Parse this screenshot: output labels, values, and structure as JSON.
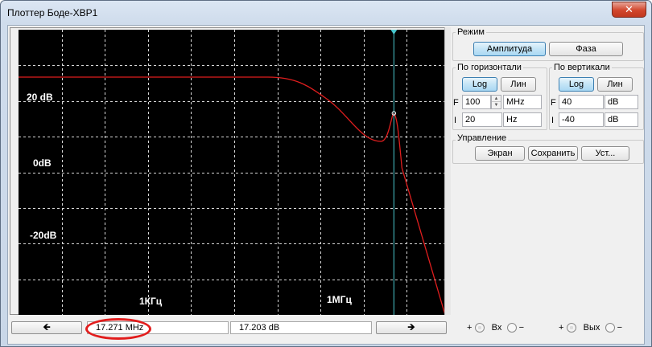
{
  "window": {
    "title": "Плоттер Боде-XBP1",
    "close_label": "✕"
  },
  "plot": {
    "labels": {
      "db20": "20 dB",
      "db0": "0dB",
      "dbm20": "-20dB",
      "f1k": "1КГц",
      "f1m": "1МГц"
    },
    "colors": {
      "trace": "#e01e1e",
      "cursor": "#49c8cf",
      "grid": "#d8d8d8",
      "background": "#000000"
    },
    "cursor_position": 0.87
  },
  "bottombar": {
    "left_arrow": "🡸",
    "right_arrow": "🡺",
    "frequency": "17.271 MHz",
    "gain": "17.203 dB"
  },
  "mode": {
    "title": "Режим",
    "amplitude": "Амплитуда",
    "phase": "Фаза"
  },
  "horizontal": {
    "title": "По горизонтали",
    "log": "Log",
    "lin": "Лин",
    "f_label": "F",
    "i_label": "I",
    "f_value": "100",
    "f_unit": "MHz",
    "i_value": "20",
    "i_unit": "Hz"
  },
  "vertical": {
    "title": "По вертикали",
    "log": "Log",
    "lin": "Лин",
    "f_label": "F",
    "i_label": "I",
    "f_value": "40",
    "f_unit": "dB",
    "i_value": "-40",
    "i_unit": "dB"
  },
  "control": {
    "title": "Управление",
    "screen": "Экран",
    "save": "Сохранить",
    "setup": "Уст..."
  },
  "terminals": {
    "plus": "+",
    "minus": "−",
    "input_label": "Вх",
    "output_label": "Вых"
  }
}
